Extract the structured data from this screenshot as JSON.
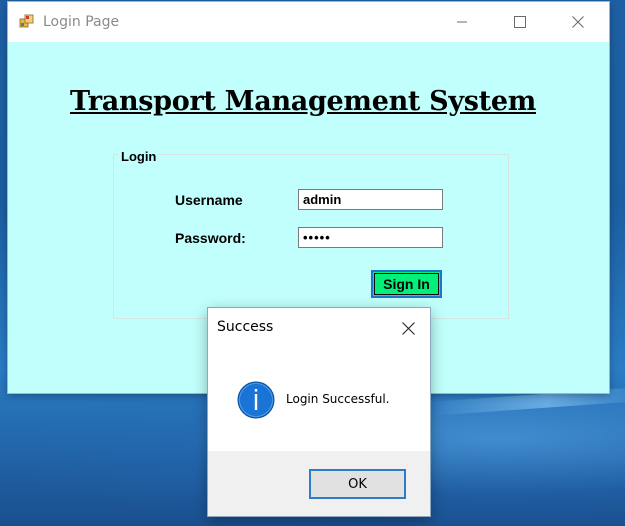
{
  "window": {
    "title": "Login Page",
    "background_color": "#c0fffb",
    "icons": {
      "app": "app-icon",
      "minimize": "minimize-icon",
      "maximize": "maximize-icon",
      "close": "close-icon"
    }
  },
  "page": {
    "heading": "Transport Management System"
  },
  "login": {
    "group_label": "Login",
    "username_label": "Username",
    "username_value": "admin",
    "password_label": "Password:",
    "password_value": "•••••",
    "signin_label": "Sign In",
    "signin_color": "#00f07a"
  },
  "dialog": {
    "title": "Success",
    "message": "Login Successful.",
    "icon": "info-icon",
    "icon_color": "#1a74d6",
    "ok_label": "OK"
  }
}
